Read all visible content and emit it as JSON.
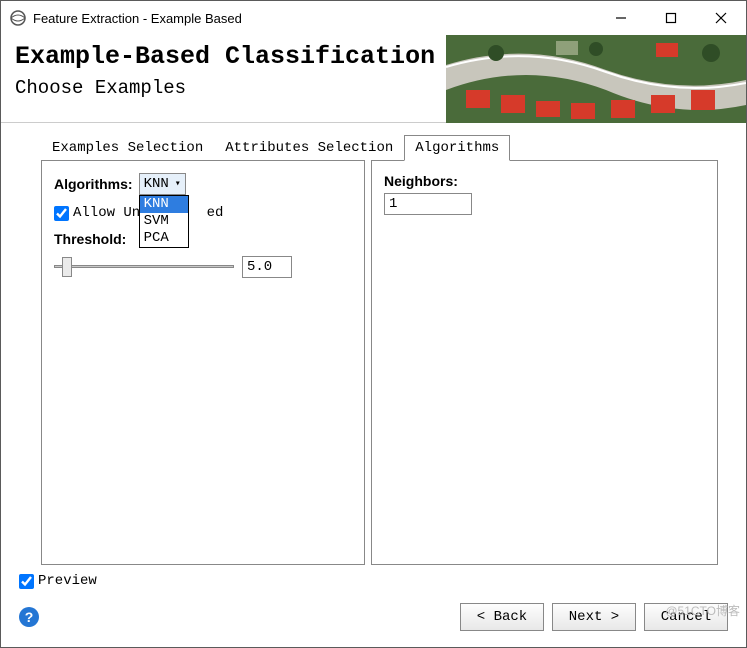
{
  "window": {
    "title": "Feature Extraction - Example Based"
  },
  "banner": {
    "title": "Example-Based Classification",
    "subtitle": "Choose Examples"
  },
  "tabs": [
    {
      "label": "Examples Selection",
      "active": false
    },
    {
      "label": "Attributes Selection",
      "active": false
    },
    {
      "label": "Algorithms",
      "active": true
    }
  ],
  "algorithms": {
    "label": "Algorithms:",
    "selected": "KNN",
    "options": [
      "KNN",
      "SVM",
      "PCA"
    ]
  },
  "allow_unclassified": {
    "label_left": "Allow Unc",
    "label_right": "ed",
    "checked": true
  },
  "threshold": {
    "label": "Threshold:",
    "value": "5.0"
  },
  "neighbors": {
    "label": "Neighbors:",
    "value": "1"
  },
  "preview": {
    "label": "Preview",
    "checked": true
  },
  "buttons": {
    "back": "< Back",
    "next": "Next >",
    "cancel": "Cancel"
  },
  "watermark": "@51CTO博客"
}
